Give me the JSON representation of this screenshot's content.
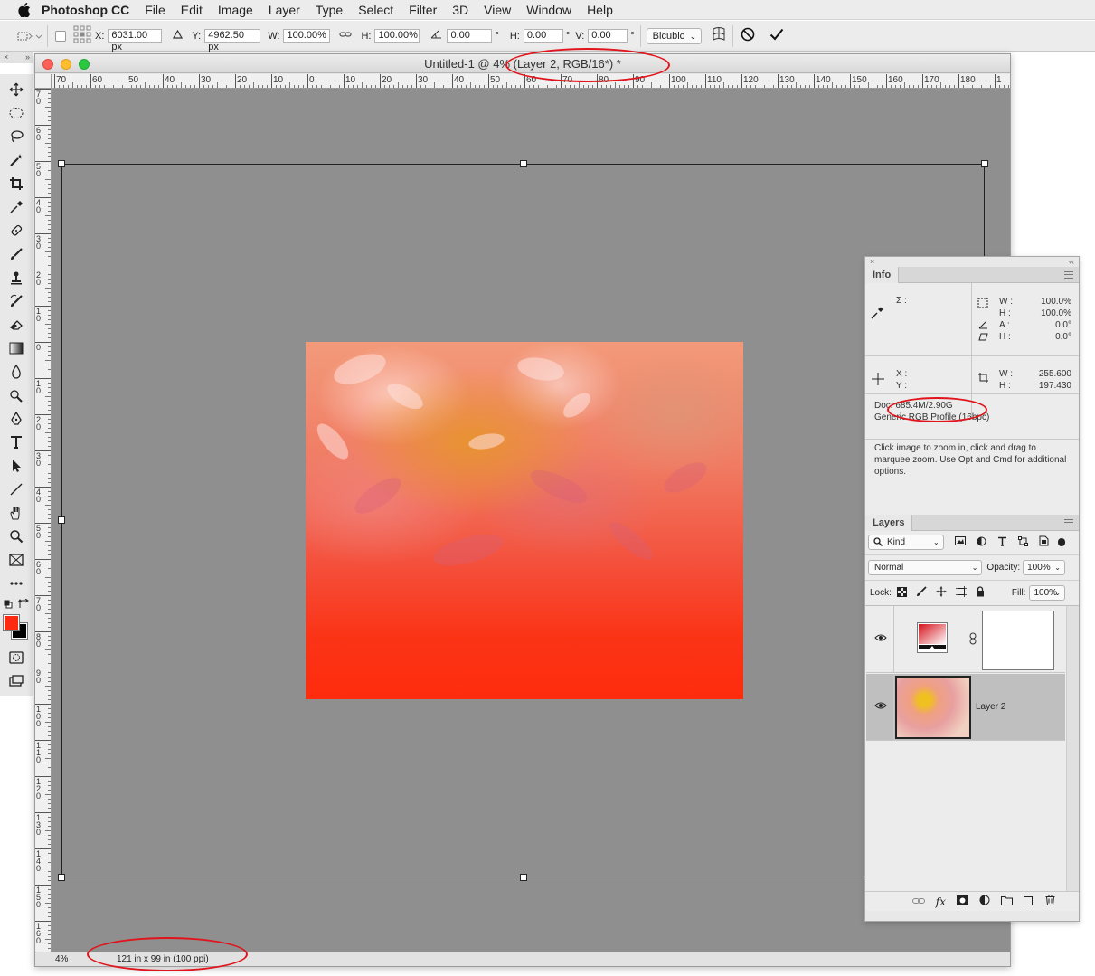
{
  "menubar": {
    "app_name": "Photoshop CC",
    "items": [
      "File",
      "Edit",
      "Image",
      "Layer",
      "Type",
      "Select",
      "Filter",
      "3D",
      "View",
      "Window",
      "Help"
    ]
  },
  "options": {
    "x_label": "X:",
    "x_value": "6031.00 px",
    "y_label": "Y:",
    "y_value": "4962.50 px",
    "w_label": "W:",
    "w_value": "100.00%",
    "h_label": "H:",
    "h_value": "100.00%",
    "angle_value": "0.00",
    "degree": "°",
    "hskew_label": "H:",
    "hskew_value": "0.00",
    "vskew_label": "V:",
    "vskew_value": "0.00",
    "interpolation": "Bicubic"
  },
  "document": {
    "title": "Untitled-1 @ 4% (Layer 2, RGB/16*) *",
    "zoom": "4%",
    "doc_size": "121 in x 99 in (100 ppi)",
    "ruler_h": [
      "70",
      "60",
      "50",
      "40",
      "30",
      "20",
      "10",
      "0",
      "10",
      "20",
      "30",
      "40",
      "50",
      "60",
      "70",
      "80",
      "90",
      "100",
      "110",
      "120",
      "130",
      "140",
      "150",
      "160",
      "170",
      "180",
      "1"
    ],
    "ruler_v": [
      "7\n0",
      "6\n0",
      "5\n0",
      "4\n0",
      "3\n0",
      "2\n0",
      "1\n0",
      "0",
      "1\n0",
      "2\n0",
      "3\n0",
      "4\n0",
      "5\n0",
      "6\n0",
      "7\n0",
      "8\n0",
      "9\n0",
      "1\n0\n0",
      "1\n1\n0",
      "1\n2\n0",
      "1\n3\n0",
      "1\n4\n0",
      "1\n5\n0",
      "1\n6\n0"
    ]
  },
  "info_panel": {
    "tab": "Info",
    "sigma": "Σ :",
    "w_label": "W :",
    "w_value": "100.0%",
    "h_label": "H :",
    "h_value": "100.0%",
    "a_label": "A :",
    "a_value": "0.0°",
    "h2_label": "H :",
    "h2_value": "0.0°",
    "x_label": "X :",
    "y_label": "Y :",
    "w2_label": "W :",
    "w2_value": "255.600",
    "h3_label": "H :",
    "h3_value": "197.430",
    "doc_line": "Doc: 685.4M/2.90G",
    "profile_line": "Generic RGB Profile (16bpc)",
    "hint": "Click image to zoom in, click and drag to marquee zoom.  Use Opt and Cmd for additional options."
  },
  "layers_panel": {
    "tab": "Layers",
    "kind": "Kind",
    "blend_mode": "Normal",
    "opacity_label": "Opacity:",
    "opacity_value": "100%",
    "lock_label": "Lock:",
    "fill_label": "Fill:",
    "fill_value": "100%",
    "layers": [
      {
        "name": ""
      },
      {
        "name": "Layer 2"
      }
    ]
  },
  "colors": {
    "foreground": "#fb2a10",
    "background": "#000000",
    "annotation": "#e0141a",
    "canvas_bg": "#8f8f8f"
  }
}
